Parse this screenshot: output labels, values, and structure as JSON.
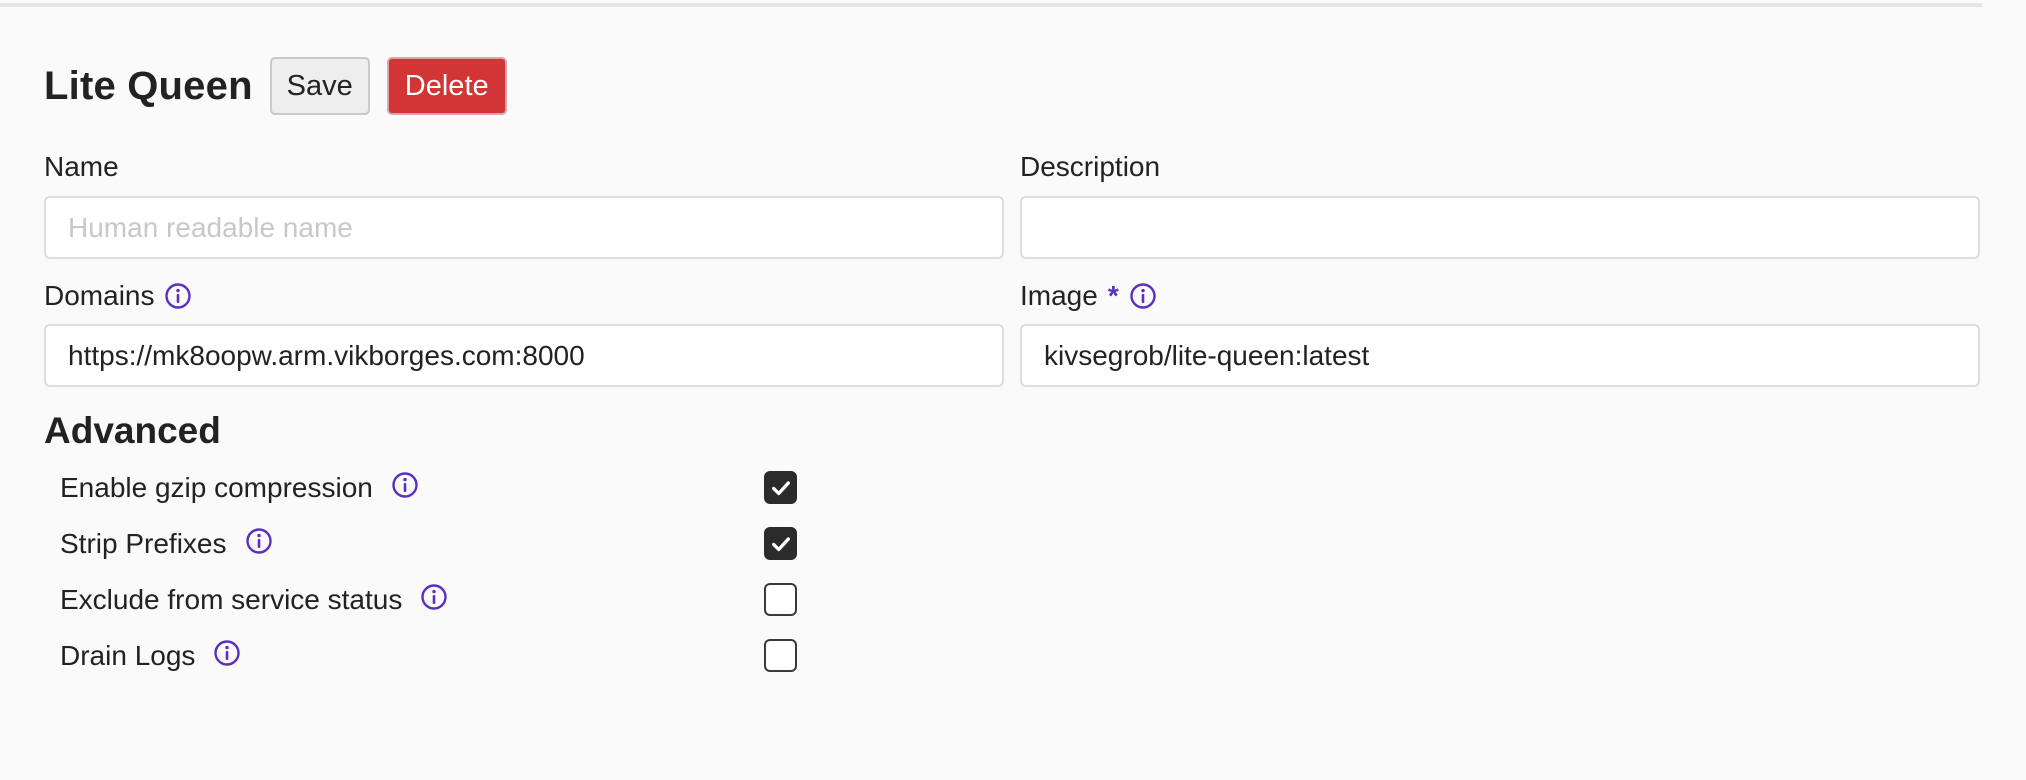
{
  "page": {
    "title": "Lite Queen"
  },
  "toolbar": {
    "save_label": "Save",
    "delete_label": "Delete"
  },
  "form": {
    "name": {
      "label": "Name",
      "value": "",
      "placeholder": "Human readable name"
    },
    "description": {
      "label": "Description",
      "value": "",
      "placeholder": ""
    },
    "domains": {
      "label": "Domains",
      "value": "https://mk8oopw.arm.vikborges.com:8000",
      "info_icon": "info-icon"
    },
    "image": {
      "label": "Image",
      "required_marker": "*",
      "value": "kivsegrob/lite-queen:latest",
      "info_icon": "info-icon"
    }
  },
  "advanced": {
    "title": "Advanced",
    "options": [
      {
        "label": "Enable gzip compression",
        "checked": true,
        "info_icon": "info-icon"
      },
      {
        "label": "Strip Prefixes",
        "checked": true,
        "info_icon": "info-icon"
      },
      {
        "label": "Exclude from service status",
        "checked": false,
        "info_icon": "info-icon"
      },
      {
        "label": "Drain Logs",
        "checked": false,
        "info_icon": "info-icon"
      }
    ]
  },
  "colors": {
    "background": "#fafafa",
    "delete_button": "#d23535",
    "accent_icon": "#5b2fbf",
    "checkbox_checked": "#2b2b2b"
  }
}
